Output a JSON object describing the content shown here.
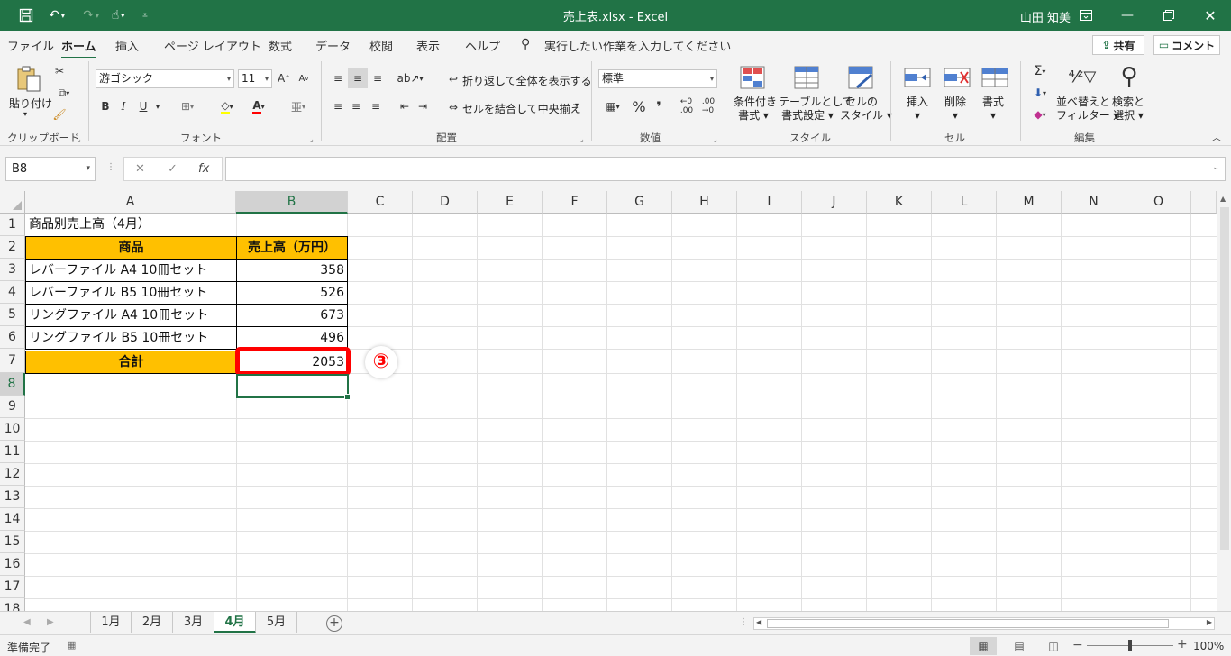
{
  "titlebar": {
    "title": "売上表.xlsx  -  Excel",
    "user": "山田 知美"
  },
  "tabs": [
    "ファイル",
    "ホーム",
    "挿入",
    "ページ レイアウト",
    "数式",
    "データ",
    "校閲",
    "表示",
    "ヘルプ"
  ],
  "active_tab": "ホーム",
  "tell_me": "実行したい作業を入力してください",
  "share_label": "共有",
  "comment_label": "コメント",
  "ribbon": {
    "clipboard": {
      "paste": "貼り付け",
      "group": "クリップボード"
    },
    "font": {
      "name": "游ゴシック",
      "size": "11",
      "bold": "B",
      "italic": "I",
      "underline": "U",
      "group": "フォント"
    },
    "alignment": {
      "wrap": "折り返して全体を表示する",
      "merge": "セルを結合して中央揃え",
      "group": "配置"
    },
    "number": {
      "format": "標準",
      "group": "数値"
    },
    "styles": {
      "conditional": [
        "条件付き",
        "書式"
      ],
      "table": [
        "テーブルとして",
        "書式設定"
      ],
      "cell": [
        "セルの",
        "スタイル"
      ],
      "group": "スタイル"
    },
    "cells": {
      "insert": "挿入",
      "delete": "削除",
      "format": "書式",
      "group": "セル"
    },
    "editing": {
      "sort": [
        "並べ替えと",
        "フィルター"
      ],
      "find": [
        "検索と",
        "選択"
      ],
      "group": "編集"
    }
  },
  "namebox": "B8",
  "formula": "",
  "columns": [
    "A",
    "B",
    "C",
    "D",
    "E",
    "F",
    "G",
    "H",
    "I",
    "J",
    "K",
    "L",
    "M",
    "N",
    "O"
  ],
  "selected_column": "B",
  "rows": [
    "1",
    "2",
    "3",
    "4",
    "5",
    "6",
    "7",
    "8",
    "9",
    "10",
    "11",
    "12",
    "13",
    "14",
    "15",
    "16",
    "17",
    "18"
  ],
  "selected_row": "8",
  "sheet": {
    "title": "商品別売上高（4月）",
    "headers": [
      "商品",
      "売上高（万円）"
    ],
    "items": [
      {
        "name": "レバーファイル A4 10冊セット",
        "value": "358"
      },
      {
        "name": "レバーファイル B5 10冊セット",
        "value": "526"
      },
      {
        "name": "リングファイル A4 10冊セット",
        "value": "673"
      },
      {
        "name": "リングファイル B5 10冊セット",
        "value": "496"
      }
    ],
    "total_label": "合計",
    "total_value": "2053"
  },
  "step_badge": "③",
  "sheets": [
    "1月",
    "2月",
    "3月",
    "4月",
    "5月"
  ],
  "active_sheet": "4月",
  "status": "準備完了",
  "zoom": "100%",
  "colors": {
    "excel_green": "#217346",
    "header_fill": "#ffc000",
    "highlight": "#ff0000"
  }
}
